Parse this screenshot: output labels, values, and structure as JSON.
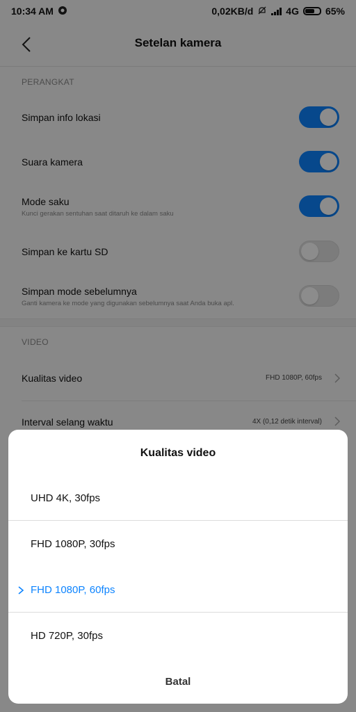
{
  "status_bar": {
    "time": "10:34 AM",
    "net_speed": "0,02KB/d",
    "network": "4G",
    "battery": "65%",
    "battery_level": 0.65
  },
  "header": {
    "title": "Setelan kamera",
    "back_icon": "chevron-left-icon"
  },
  "sections": {
    "device": {
      "header": "PERANGKAT",
      "items": [
        {
          "label": "Simpan info lokasi",
          "sub": "",
          "on": true
        },
        {
          "label": "Suara kamera",
          "sub": "",
          "on": true
        },
        {
          "label": "Mode saku",
          "sub": "Kunci gerakan sentuhan saat ditaruh ke dalam saku",
          "on": true
        },
        {
          "label": "Simpan ke kartu SD",
          "sub": "",
          "on": false
        },
        {
          "label": "Simpan mode sebelumnya",
          "sub": "Ganti kamera ke mode yang digunakan sebelumnya saat Anda buka apl.",
          "on": false
        }
      ]
    },
    "video": {
      "header": "VIDEO",
      "items": [
        {
          "label": "Kualitas video",
          "value": "FHD 1080P, 60fps"
        },
        {
          "label": "Interval selang waktu",
          "value": "4X (0,12 detik interval)"
        }
      ]
    }
  },
  "dialog": {
    "title": "Kualitas video",
    "options": [
      {
        "label": "UHD 4K, 30fps",
        "selected": false
      },
      {
        "label": "FHD 1080P, 30fps",
        "selected": false
      },
      {
        "label": "FHD 1080P, 60fps",
        "selected": true
      },
      {
        "label": "HD 720P, 30fps",
        "selected": false
      }
    ],
    "cancel_label": "Batal"
  },
  "colors": {
    "accent": "#0d84ff",
    "toggle_off": "#e2e2e2",
    "background": "#f7f7f7"
  }
}
